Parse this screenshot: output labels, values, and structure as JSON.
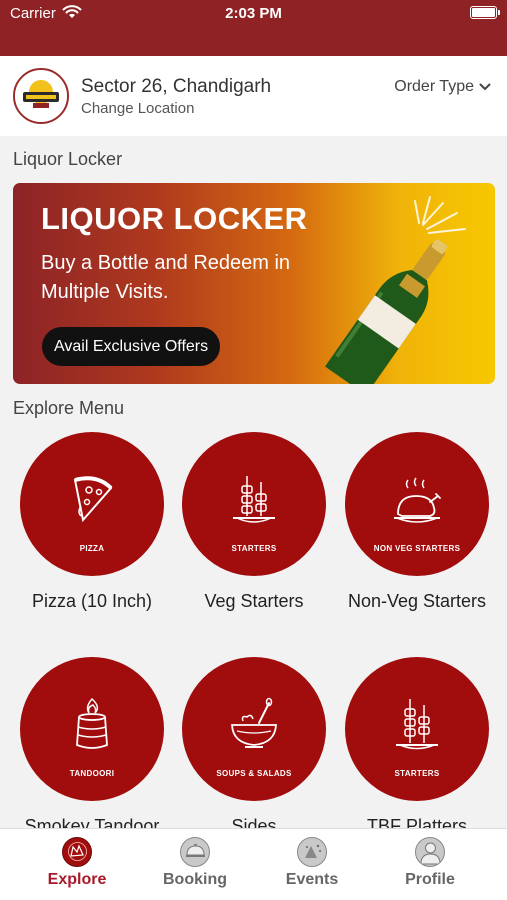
{
  "status_bar": {
    "carrier": "Carrier",
    "time": "2:03 PM"
  },
  "location": {
    "title": "Sector 26, Chandigarh",
    "subtitle": "Change Location",
    "order_type": "Order Type"
  },
  "liquor_section": {
    "title": "Liquor Locker"
  },
  "banner": {
    "title": "LIQUOR LOCKER",
    "text": "Buy a Bottle and Redeem in Multiple Visits.",
    "button": "Avail Exclusive Offers"
  },
  "explore_section": {
    "title": "Explore Menu"
  },
  "menu": [
    {
      "caption": "PIZZA",
      "label": "Pizza (10 Inch)",
      "icon": "pizza-icon"
    },
    {
      "caption": "STARTERS",
      "label": "Veg Starters",
      "icon": "skewer-icon"
    },
    {
      "caption": "NON VEG STARTERS",
      "label": "Non-Veg Starters",
      "icon": "roast-chicken-icon"
    },
    {
      "caption": "TANDOORI",
      "label": "Smokey Tandoor",
      "icon": "tandoor-icon"
    },
    {
      "caption": "SOUPS & SALADS",
      "label": "Sides",
      "icon": "soup-bowl-icon"
    },
    {
      "caption": "STARTERS",
      "label": "TBF Platters",
      "icon": "skewer-icon"
    }
  ],
  "tabs": [
    {
      "label": "Explore",
      "icon": "explore-icon",
      "active": true
    },
    {
      "label": "Booking",
      "icon": "cloche-icon"
    },
    {
      "label": "Events",
      "icon": "events-icon"
    },
    {
      "label": "Profile",
      "icon": "profile-icon"
    }
  ],
  "colors": {
    "primary": "#8e2225",
    "circle": "#a10c0d",
    "accent_text": "#a8192a"
  }
}
